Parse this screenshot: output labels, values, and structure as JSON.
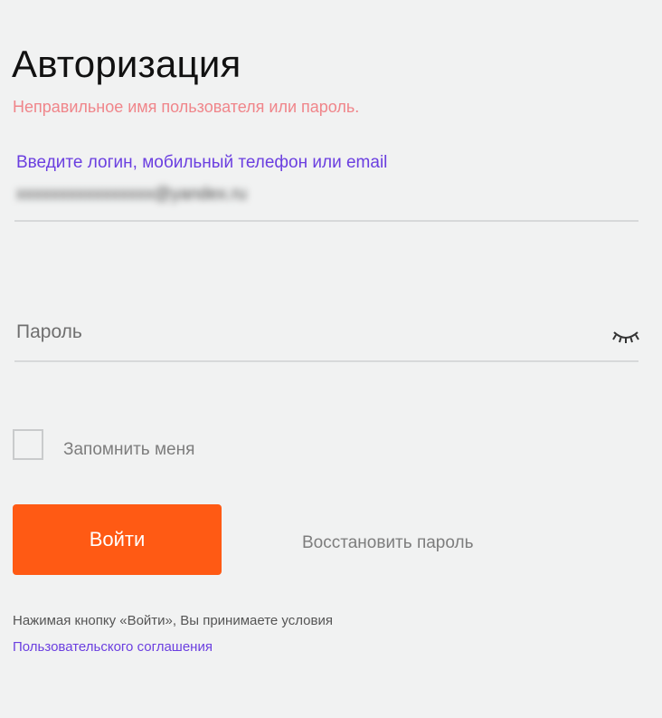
{
  "page": {
    "title": "Авторизация",
    "error_message": "Неправильное имя пользователя или пароль."
  },
  "login_field": {
    "label": "Введите логин, мобильный телефон или email",
    "value": "xxxxxxxxxxxxxxxx@yandex.ru"
  },
  "password_field": {
    "placeholder": "Пароль",
    "toggle_icon": "eye-closed-icon"
  },
  "remember": {
    "label": "Запомнить меня",
    "checked": false
  },
  "actions": {
    "submit_label": "Войти",
    "restore_label": "Восстановить пароль"
  },
  "terms": {
    "text": "Нажимая кнопку «Войти», Вы принимаете условия",
    "link": "Пользовательского соглашения"
  },
  "colors": {
    "accent": "#ff5a14",
    "link": "#6b3fe0",
    "error": "#f0858a",
    "background": "#f1f2f2"
  }
}
